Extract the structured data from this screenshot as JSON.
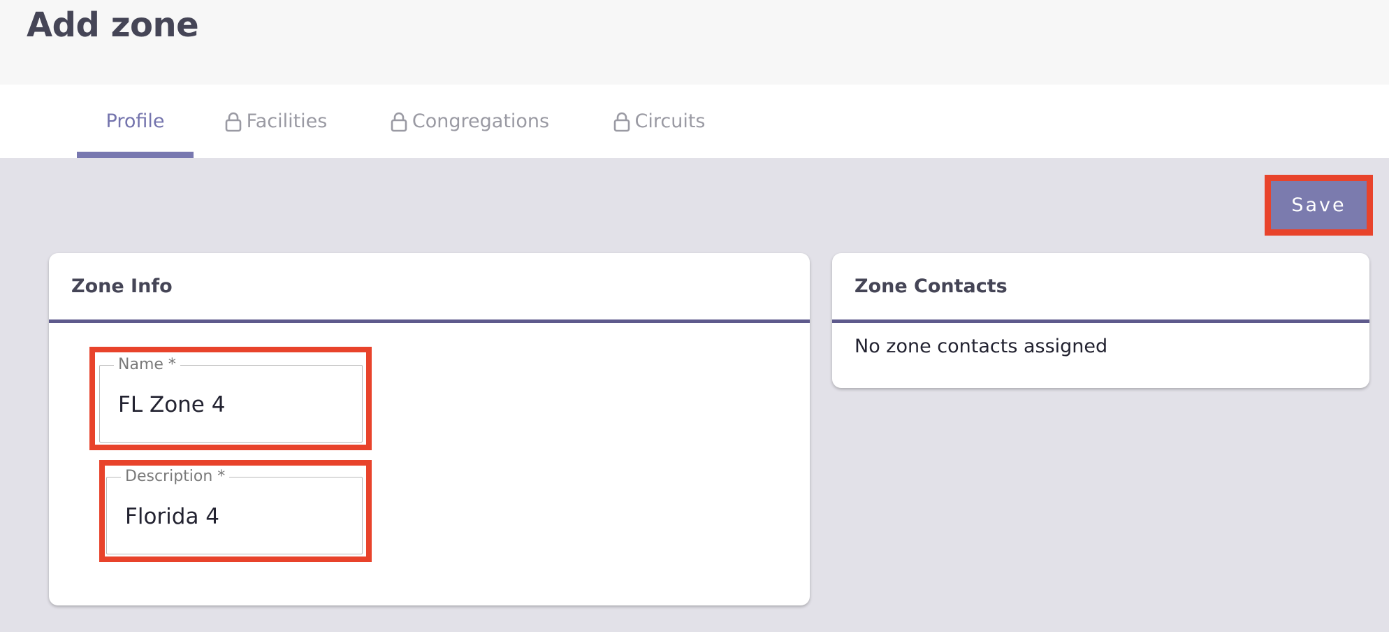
{
  "header": {
    "title": "Add zone"
  },
  "tabs": [
    {
      "label": "Profile",
      "locked": false,
      "active": true
    },
    {
      "label": "Facilities",
      "locked": true,
      "active": false
    },
    {
      "label": "Congregations",
      "locked": true,
      "active": false
    },
    {
      "label": "Circuits",
      "locked": true,
      "active": false
    }
  ],
  "toolbar": {
    "save_label": "Save"
  },
  "zone_info": {
    "title": "Zone Info",
    "name": {
      "label": "Name *",
      "value": "FL Zone 4"
    },
    "description": {
      "label": "Description *",
      "value": "Florida 4"
    }
  },
  "zone_contacts": {
    "title": "Zone Contacts",
    "empty_text": "No zone contacts assigned"
  },
  "colors": {
    "accent": "#7878b0",
    "highlight": "#e8432b",
    "card_divider": "#5e5a8c"
  }
}
